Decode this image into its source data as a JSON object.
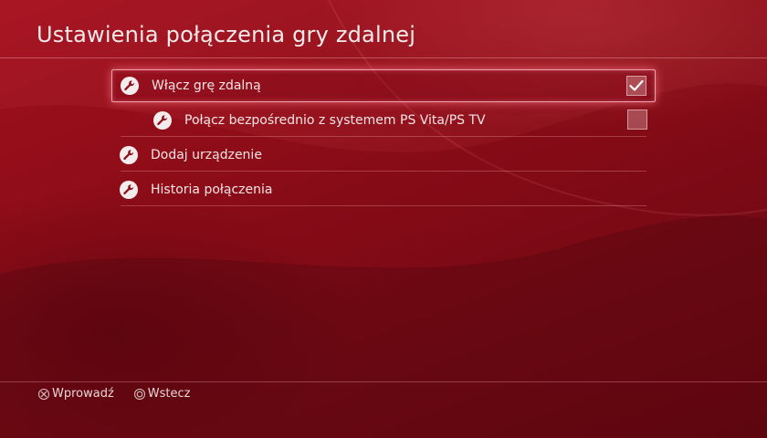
{
  "screen": {
    "title": "Ustawienia połączenia gry zdalnej"
  },
  "menu": {
    "items": [
      {
        "label": "Włącz grę zdalną",
        "icon": "wrench-icon",
        "checkbox": true,
        "checked": true,
        "selected": true,
        "indent": 1
      },
      {
        "label": "Połącz bezpośrednio z systemem PS Vita/PS TV",
        "icon": "wrench-icon",
        "checkbox": true,
        "checked": false,
        "selected": false,
        "indent": 2
      },
      {
        "label": "Dodaj urządzenie",
        "icon": "wrench-icon",
        "checkbox": false,
        "selected": false,
        "indent": 1
      },
      {
        "label": "Historia połączenia",
        "icon": "wrench-icon",
        "checkbox": false,
        "selected": false,
        "indent": 1
      }
    ]
  },
  "footer": {
    "confirm": {
      "icon": "cross-button-icon",
      "label": "Wprowadź"
    },
    "back": {
      "icon": "circle-button-icon",
      "label": "Wstecz"
    }
  },
  "colors": {
    "background": "#8c0c18",
    "selection_border": "#f2a2ad",
    "text": "#f3e4e4"
  }
}
